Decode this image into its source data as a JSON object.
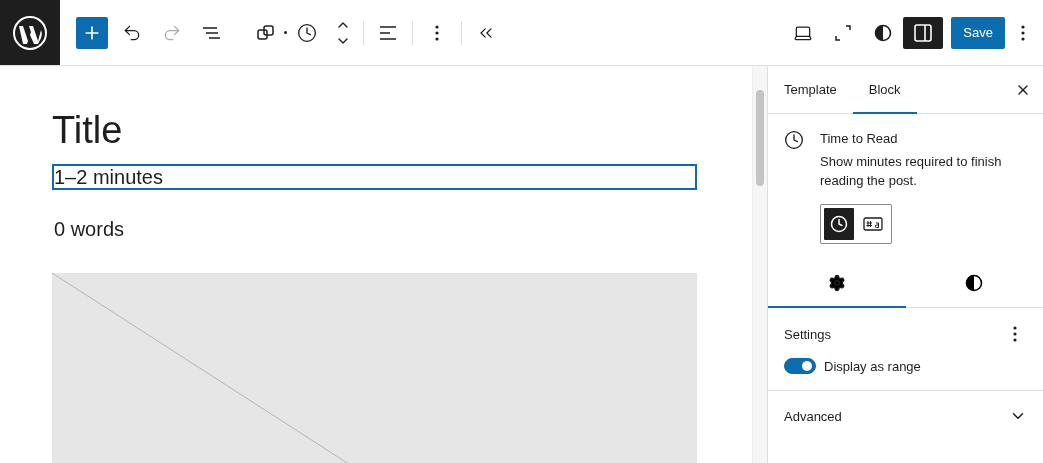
{
  "toolbar": {
    "settings_open": true,
    "save": "Save"
  },
  "canvas": {
    "title": "Title",
    "blocks": [
      {
        "kind": "time",
        "text": "1–2 minutes",
        "selected": true
      },
      {
        "kind": "text",
        "text": "0 words",
        "selected": false
      },
      {
        "kind": "placeholder",
        "selected": false
      }
    ]
  },
  "sidebar": {
    "tabs": [
      {
        "label": "Template",
        "selected": false
      },
      {
        "label": "Block",
        "selected": true
      }
    ],
    "block": {
      "title": "Time to Read",
      "description": "Show minutes required to finish reading the post.",
      "variations": [
        {
          "kind": "time",
          "selected": true
        },
        {
          "kind": "word-count",
          "selected": false
        }
      ]
    },
    "inspector_tabs": [
      {
        "kind": "settings",
        "selected": true
      },
      {
        "kind": "styles",
        "selected": false
      }
    ],
    "settings": {
      "title": "Settings",
      "toggle": {
        "label": "Display as range",
        "on": true
      }
    },
    "advanced": {
      "title": "Advanced",
      "expanded": false
    }
  }
}
